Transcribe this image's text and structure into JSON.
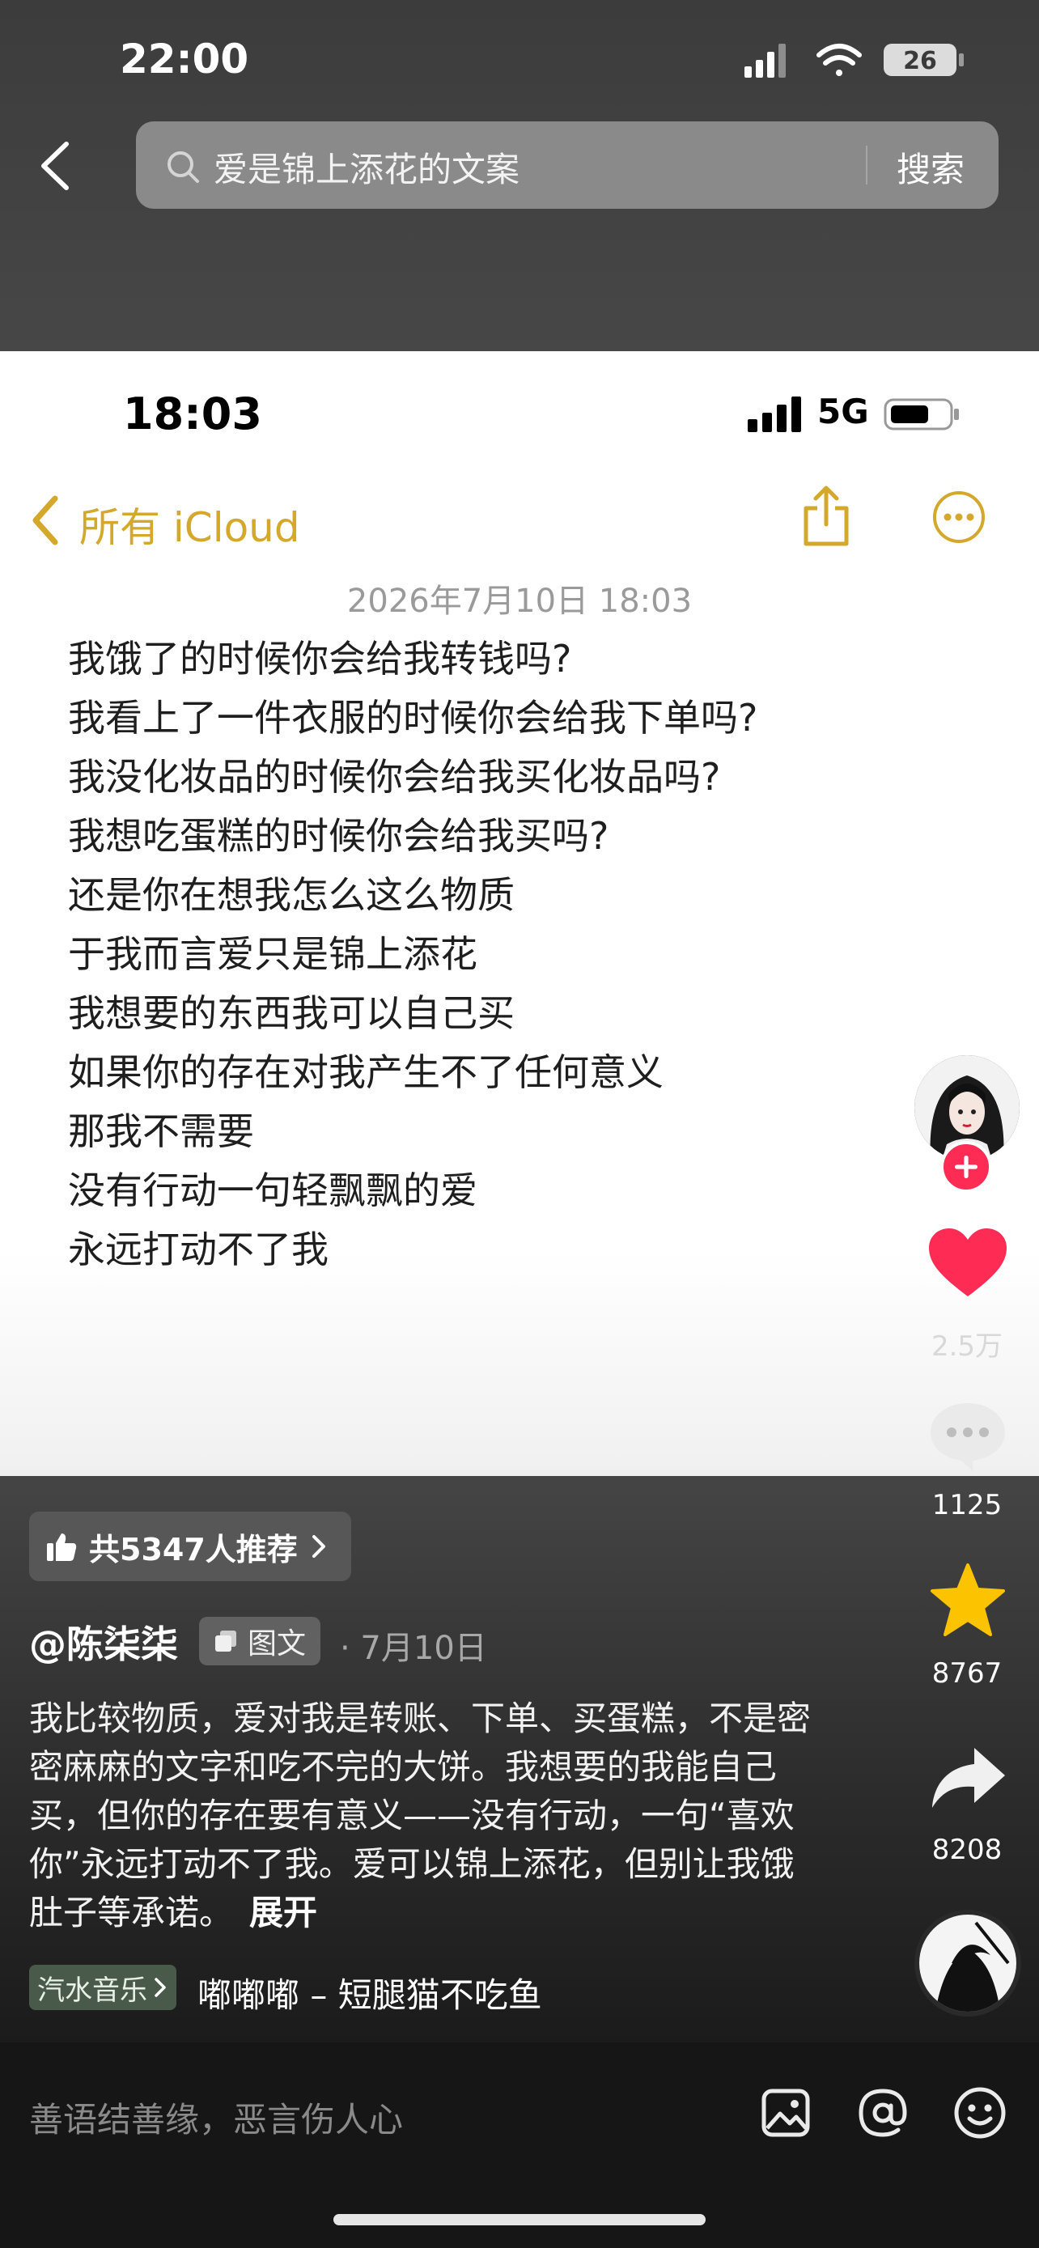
{
  "status_bar": {
    "time": "22:00",
    "battery": "26"
  },
  "search": {
    "query": "爱是锦上添花的文案",
    "button_label": "搜索"
  },
  "notes_screenshot": {
    "status_time": "18:03",
    "network": "5G",
    "back_label": "所有 iCloud",
    "date": "2026年7月10日 18:03",
    "lines": [
      "我饿了的时候你会给我转钱吗?",
      "我看上了一件衣服的时候你会给我下单吗?",
      "我没化妆品的时候你会给我买化妆品吗?",
      "我想吃蛋糕的时候你会给我买吗?",
      "还是你在想我怎么这么物质",
      "于我而言爱只是锦上添花",
      "我想要的东西我可以自己买",
      "如果你的存在对我产生不了任何意义",
      "那我不需要",
      "没有行动一句轻飘飘的爱",
      "永远打动不了我"
    ]
  },
  "recommendation": {
    "label": "共5347人推荐"
  },
  "post": {
    "author": "@陈柒柒",
    "type_label": "图文",
    "date": "· 7月10日",
    "caption": "我比较物质，爱对我是转账、下单、买蛋糕，不是密密麻麻的文字和吃不完的大饼。我想要的我能自己买，但你的存在要有意义——没有行动，一句“喜欢你”永远打动不了我。爱可以锦上添花，但别让我饿肚子等承诺。",
    "expand_label": "展开",
    "music_label": "汽水音乐",
    "music_track": "嘟嘟嘟 – 短腿猫不吃鱼"
  },
  "actions": {
    "likes": "2.5万",
    "comments": "1125",
    "favorites": "8767",
    "shares": "8208"
  },
  "comment_bar": {
    "placeholder": "善语结善缘，恶言伤人心"
  },
  "colors": {
    "accent_notes": "#d4a82b",
    "like_red": "#fe2c55",
    "star_yellow": "#fcc400"
  }
}
